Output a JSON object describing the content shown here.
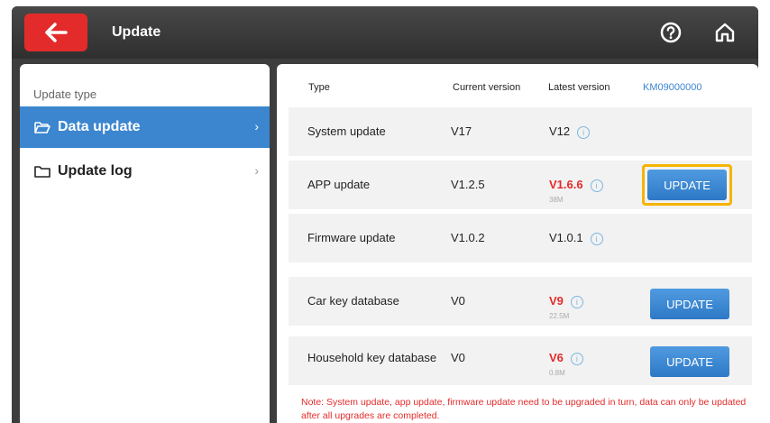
{
  "header": {
    "title": "Update",
    "back_icon": "arrow-left-icon",
    "help_icon": "help-circle-icon",
    "home_icon": "home-icon"
  },
  "sidebar": {
    "heading": "Update type",
    "items": [
      {
        "label": "Data update",
        "icon": "folder-open-icon",
        "active": true
      },
      {
        "label": "Update log",
        "icon": "folder-icon",
        "active": false
      }
    ]
  },
  "table": {
    "headers": {
      "type": "Type",
      "current": "Current version",
      "latest": "Latest version",
      "serial": "KM09000000"
    },
    "rows": [
      {
        "type": "System update",
        "current": "V17",
        "latest": "V12",
        "latest_color": "black",
        "size": "",
        "button": ""
      },
      {
        "type": "APP update",
        "current": "V1.2.5",
        "latest": "V1.6.6",
        "latest_color": "red",
        "size": "38M",
        "button": "UPDATE"
      },
      {
        "type": "Firmware update",
        "current": "V1.0.2",
        "latest": "V1.0.1",
        "latest_color": "black",
        "size": "",
        "button": ""
      },
      {
        "type": "Car key database",
        "current": "V0",
        "latest": "V9",
        "latest_color": "red",
        "size": "22.5M",
        "button": "UPDATE"
      },
      {
        "type": "Household key database",
        "current": "V0",
        "latest": "V6",
        "latest_color": "red",
        "size": "0.8M",
        "button": "UPDATE"
      }
    ]
  },
  "note": "Note: System update, app update, firmware update need to be upgraded in turn, data can only be updated after all upgrades are completed.",
  "colors": {
    "accent": "#3c86cf",
    "alert": "#e42b2b",
    "highlight": "#f5b400",
    "titlebar": "#3d3d3d"
  }
}
